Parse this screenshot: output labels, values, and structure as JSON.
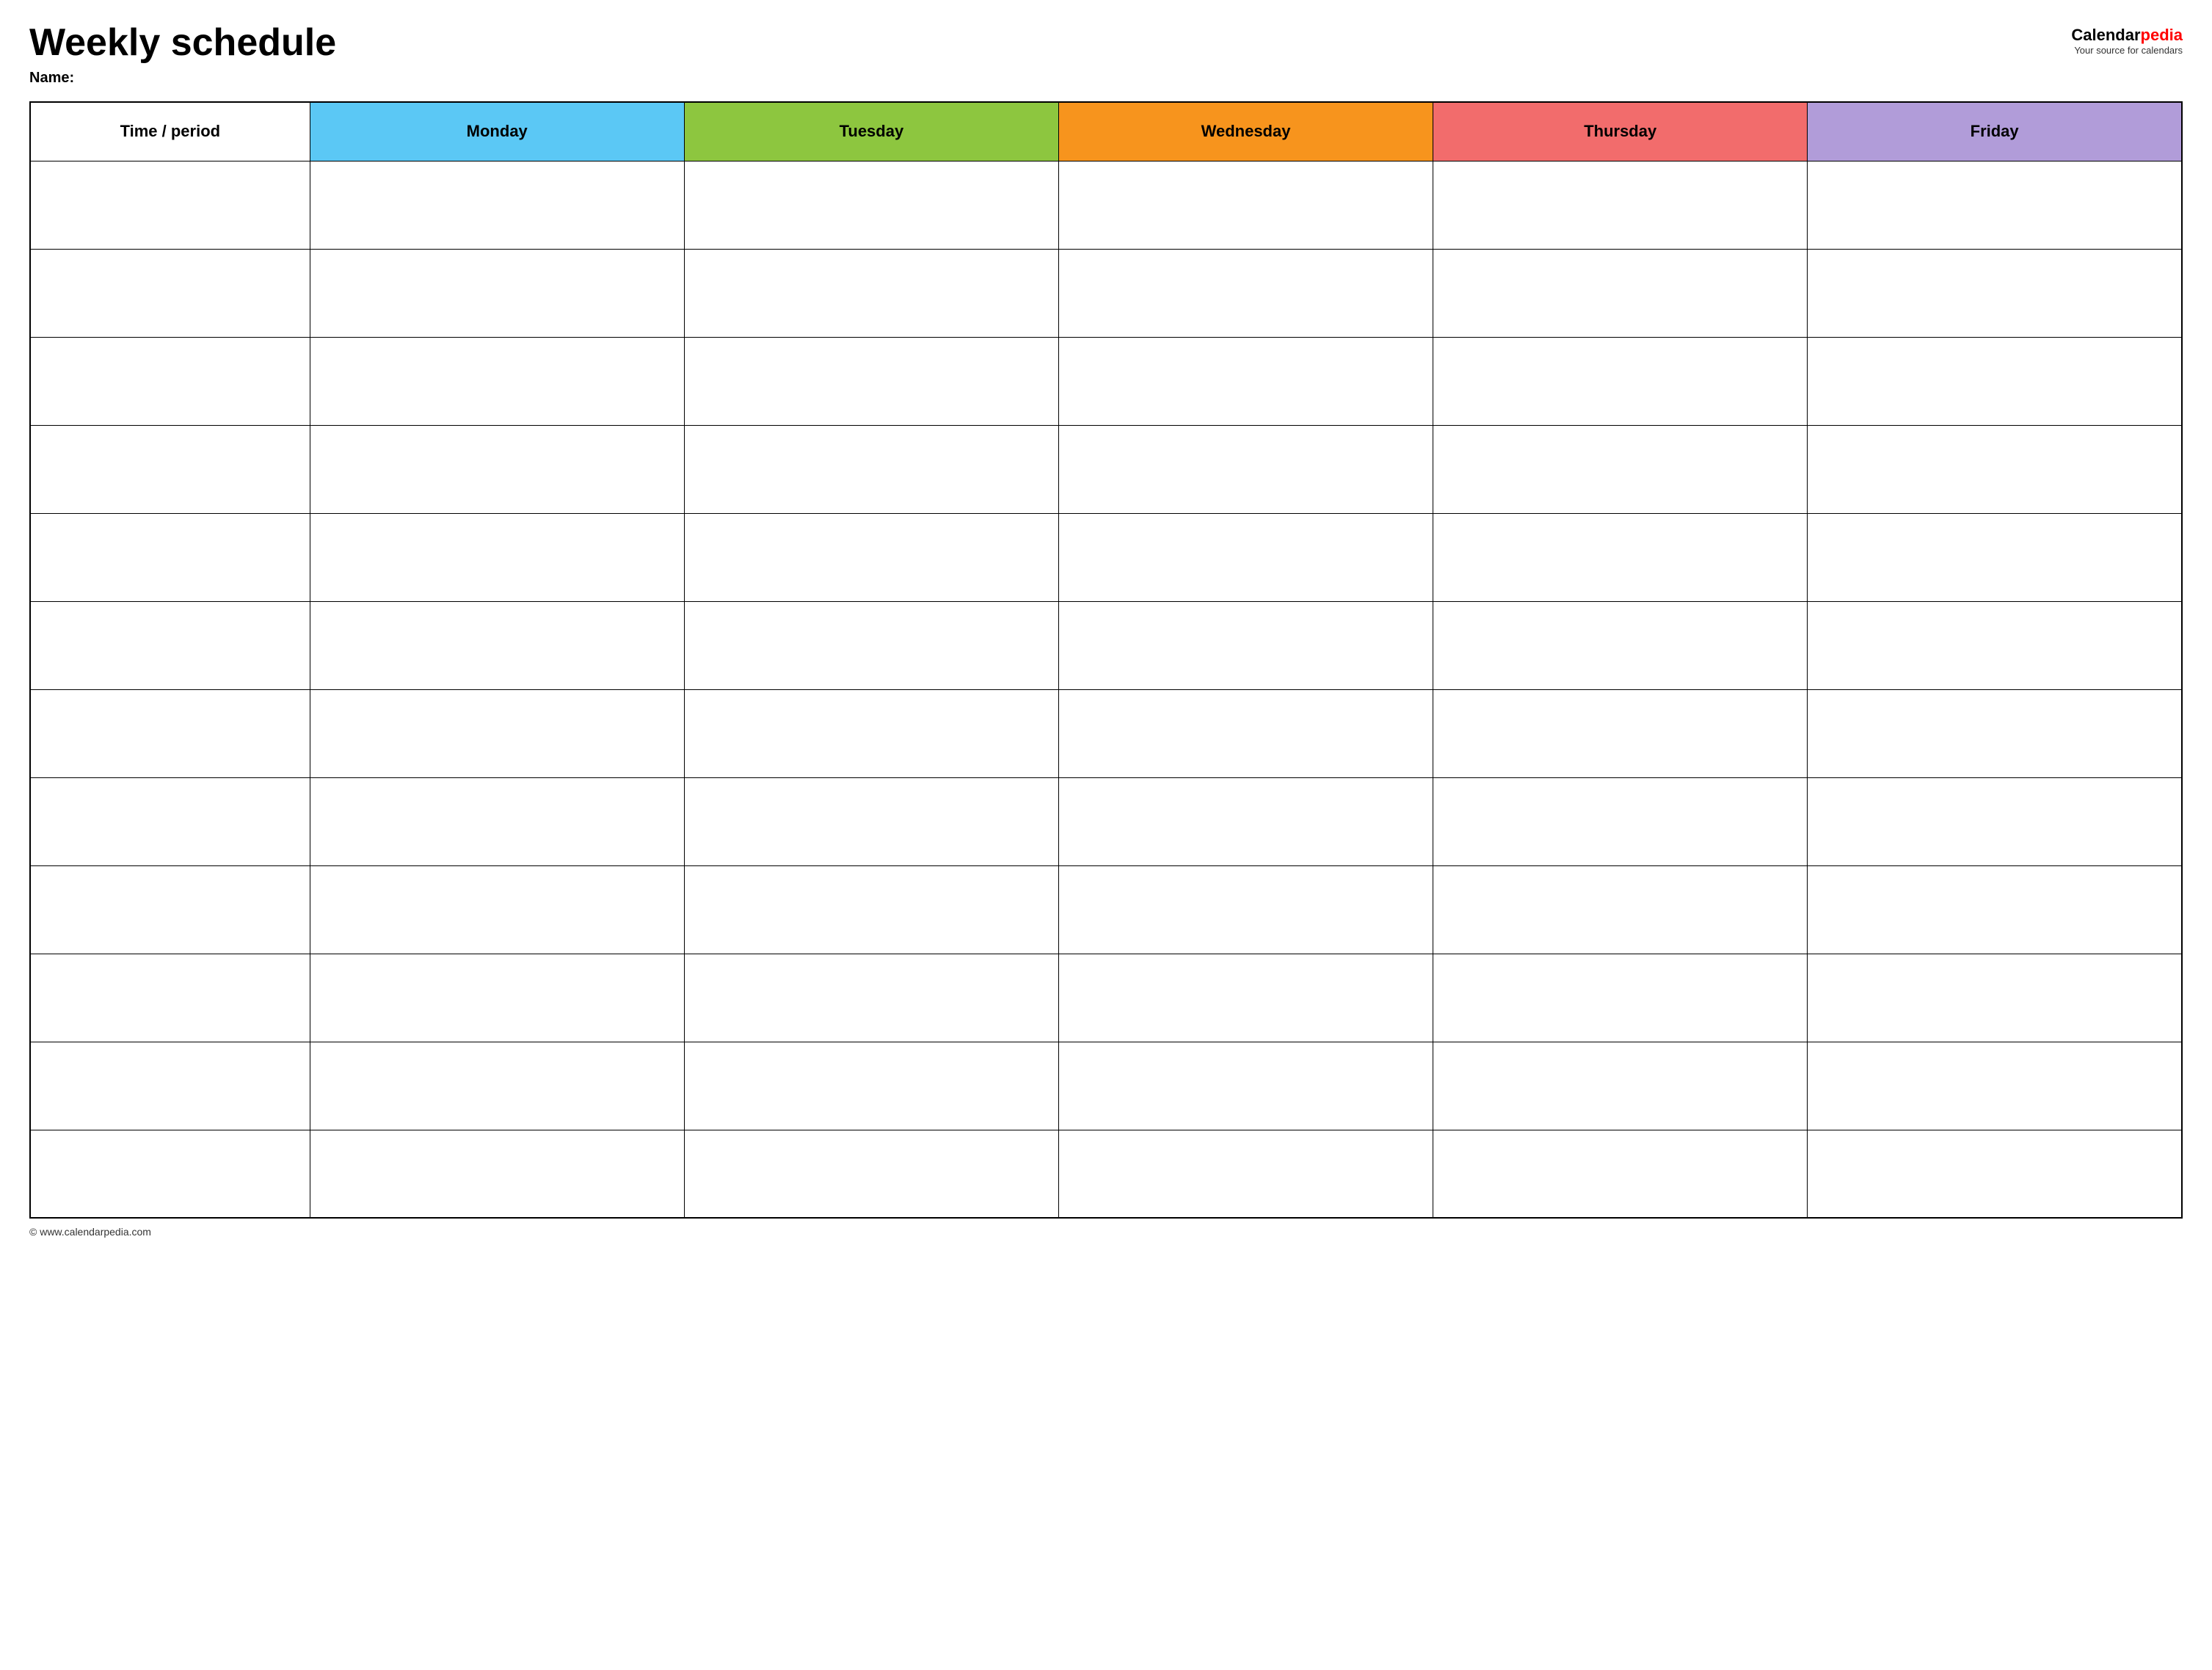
{
  "header": {
    "title": "Weekly schedule",
    "name_label": "Name:",
    "logo_calendar": "Calendar",
    "logo_pedia": "pedia",
    "logo_tagline": "Your source for calendars"
  },
  "table": {
    "columns": [
      {
        "key": "time",
        "label": "Time / period",
        "color": "#ffffff",
        "text_color": "#000000"
      },
      {
        "key": "monday",
        "label": "Monday",
        "color": "#5bc8f5",
        "text_color": "#000000"
      },
      {
        "key": "tuesday",
        "label": "Tuesday",
        "color": "#8dc63f",
        "text_color": "#000000"
      },
      {
        "key": "wednesday",
        "label": "Wednesday",
        "color": "#f7941d",
        "text_color": "#000000"
      },
      {
        "key": "thursday",
        "label": "Thursday",
        "color": "#f26c6c",
        "text_color": "#000000"
      },
      {
        "key": "friday",
        "label": "Friday",
        "color": "#b19cd9",
        "text_color": "#000000"
      }
    ],
    "row_count": 12
  },
  "footer": {
    "copyright": "© www.calendarpedia.com"
  }
}
